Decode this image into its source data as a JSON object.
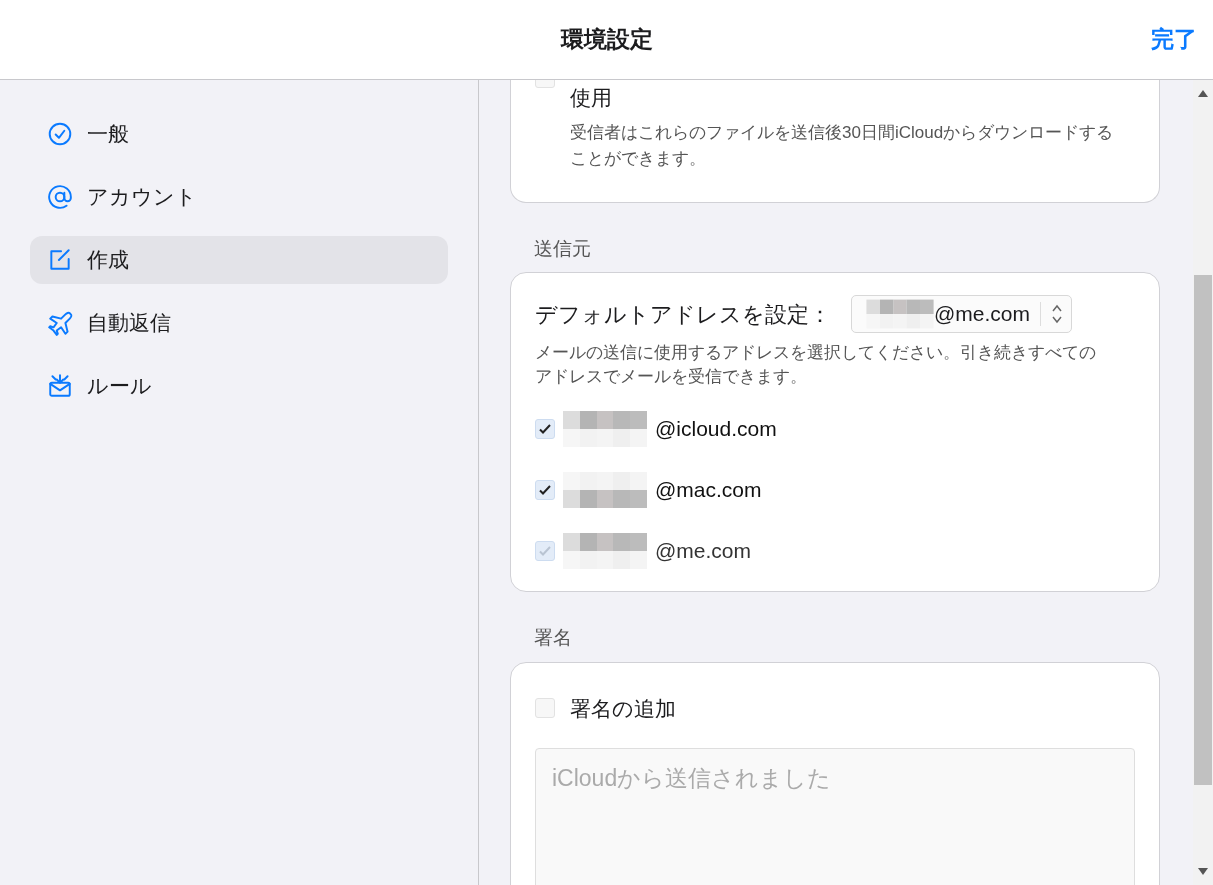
{
  "header": {
    "title": "環境設定",
    "done": "完了"
  },
  "sidebar": {
    "items": [
      {
        "kind": "general",
        "label": "一般",
        "selected": false
      },
      {
        "kind": "account",
        "label": "アカウント",
        "selected": false
      },
      {
        "kind": "compose",
        "label": "作成",
        "selected": true
      },
      {
        "kind": "autoreply",
        "label": "自動返信",
        "selected": false
      },
      {
        "kind": "rules",
        "label": "ルール",
        "selected": false
      }
    ]
  },
  "mail_drop": {
    "checked": false,
    "label_visible": "使用",
    "description": "受信者はこれらのファイルを送信後30日間iCloudからダウンロードすることができます。"
  },
  "from_section": {
    "heading": "送信元",
    "default_label": "デフォルトアドレスを設定：",
    "default_value": "@me.com",
    "description": "メールの送信に使用するアドレスを選択してください。引き続きすべてのアドレスでメールを受信できます。",
    "addresses": [
      {
        "domain": "@icloud.com",
        "checked": true,
        "disabled": false
      },
      {
        "domain": "@mac.com",
        "checked": true,
        "disabled": false
      },
      {
        "domain": "@me.com",
        "checked": true,
        "disabled": true
      }
    ]
  },
  "signature_section": {
    "heading": "署名",
    "add_label": "署名の追加",
    "checked": false,
    "placeholder": "iCloudから送信されました"
  }
}
